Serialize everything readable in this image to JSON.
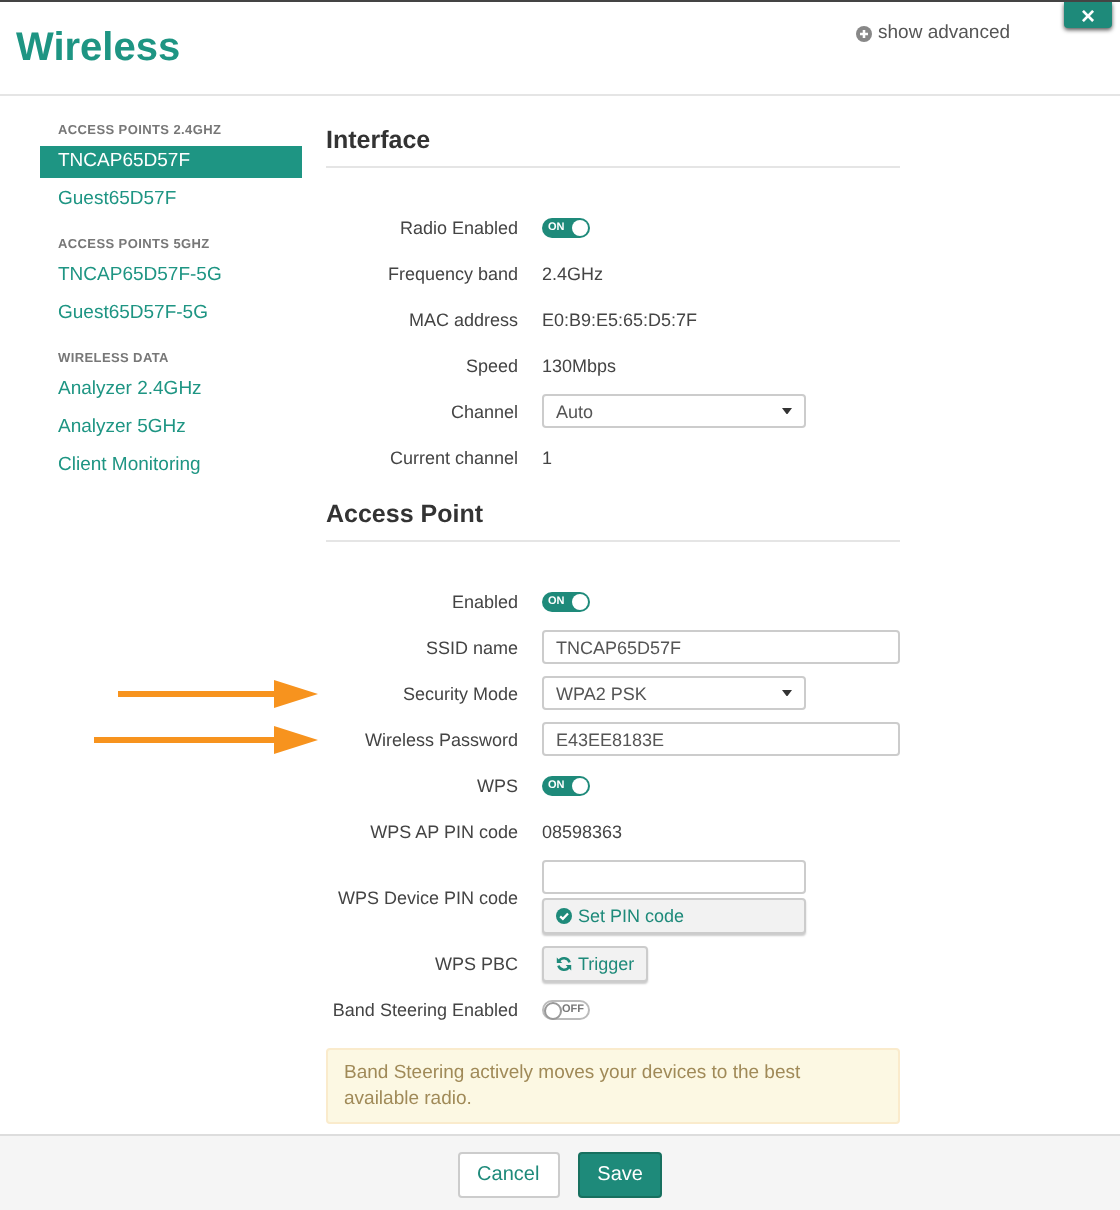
{
  "header": {
    "title": "Wireless",
    "advanced_link": "show advanced",
    "close": "×"
  },
  "sidebar": {
    "sections": [
      {
        "heading": "ACCESS POINTS 2.4GHZ",
        "items": [
          {
            "label": "TNCAP65D57F",
            "selected": true
          },
          {
            "label": "Guest65D57F",
            "selected": false
          }
        ]
      },
      {
        "heading": "ACCESS POINTS 5GHZ",
        "items": [
          {
            "label": "TNCAP65D57F-5G",
            "selected": false
          },
          {
            "label": "Guest65D57F-5G",
            "selected": false
          }
        ]
      },
      {
        "heading": "WIRELESS DATA",
        "items": [
          {
            "label": "Analyzer 2.4GHz",
            "selected": false
          },
          {
            "label": "Analyzer 5GHz",
            "selected": false
          },
          {
            "label": "Client Monitoring",
            "selected": false
          }
        ]
      }
    ]
  },
  "sections": [
    {
      "title": "Interface",
      "rows": [
        {
          "label": "Radio Enabled",
          "kind": "toggle",
          "on": true,
          "value": "ON",
          "pointed_at": false
        },
        {
          "label": "Frequency band",
          "kind": "text",
          "value": "2.4GHz",
          "pointed_at": false
        },
        {
          "label": "MAC address",
          "kind": "text",
          "value": "E0:B9:E5:65:D5:7F",
          "pointed_at": false
        },
        {
          "label": "Speed",
          "kind": "text",
          "value": "130Mbps",
          "pointed_at": false
        },
        {
          "label": "Channel",
          "kind": "select",
          "value": "Auto",
          "pointed_at": false
        },
        {
          "label": "Current channel",
          "kind": "text",
          "value": "1",
          "pointed_at": false
        }
      ]
    },
    {
      "title": "Access Point",
      "rows": [
        {
          "label": "Enabled",
          "kind": "toggle",
          "on": true,
          "value": "ON",
          "pointed_at": false
        },
        {
          "label": "SSID name",
          "kind": "input",
          "value": "TNCAP65D57F",
          "pointed_at": false
        },
        {
          "label": "Security Mode",
          "kind": "select",
          "value": "WPA2 PSK",
          "pointed_at": true
        },
        {
          "label": "Wireless Password",
          "kind": "input",
          "value": "E43EE8183E",
          "pointed_at": true
        },
        {
          "label": "WPS",
          "kind": "toggle",
          "on": true,
          "value": "ON",
          "pointed_at": false
        },
        {
          "label": "WPS AP PIN code",
          "kind": "text",
          "value": "08598363",
          "pointed_at": false
        },
        {
          "label": "WPS Device PIN code",
          "kind": "input_button",
          "button": "Set PIN code",
          "pointed_at": false
        },
        {
          "label": "WPS PBC",
          "kind": "button",
          "button": "Trigger",
          "pointed_at": false
        },
        {
          "label": "Band Steering Enabled",
          "kind": "toggle",
          "on": false,
          "value": "OFF",
          "pointed_at": false
        }
      ]
    }
  ],
  "notice": "Band Steering actively moves your devices to the best available radio.",
  "footer": {
    "buttons": [
      {
        "label": "Cancel",
        "kind": "default"
      },
      {
        "label": "Save",
        "kind": "primary"
      }
    ]
  }
}
